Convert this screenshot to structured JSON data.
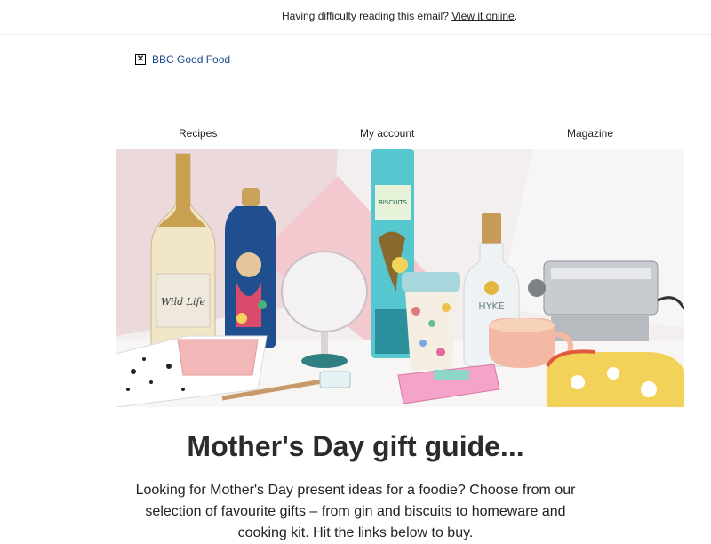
{
  "preheader": {
    "text": "Having difficulty reading this email?",
    "link_label": "View it online",
    "suffix": "."
  },
  "logo": {
    "broken_image_icon": "broken-image-icon",
    "alt_text": "BBC Good Food"
  },
  "nav": {
    "items": [
      "Recipes",
      "My account",
      "Magazine"
    ]
  },
  "hero": {
    "bottle_label": "Wild Life",
    "gin_label": "HYKE",
    "tin_label": "BISCUITS"
  },
  "headline": "Mother's Day gift guide...",
  "intro": "Looking for Mother's Day present ideas for a foodie? Choose from our selection of favourite gifts – from gin and biscuits to homeware and cooking kit. Hit the links below to buy."
}
